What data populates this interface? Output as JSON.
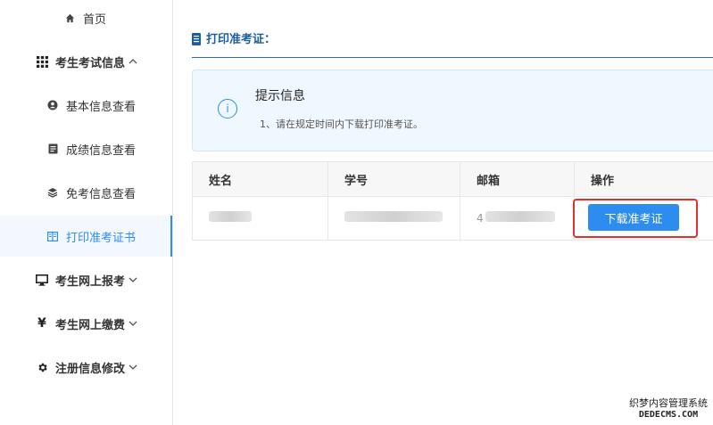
{
  "sidebar": {
    "items": [
      {
        "label": "首页",
        "icon": "home-icon",
        "top": 0
      },
      {
        "label": "考生考试信息",
        "icon": "grid-icon",
        "group": true,
        "expanded": true
      },
      {
        "label": "基本信息查看",
        "icon": "user-icon"
      },
      {
        "label": "成绩信息查看",
        "icon": "doc-icon"
      },
      {
        "label": "免考信息查看",
        "icon": "layers-icon"
      },
      {
        "label": "打印准考证书",
        "icon": "book-icon",
        "active": true
      },
      {
        "label": "考生网上报考",
        "icon": "monitor-icon",
        "group": true
      },
      {
        "label": "考生网上缴费",
        "icon": "yen-icon",
        "group": true
      },
      {
        "label": "注册信息修改",
        "icon": "gear-icon",
        "group": true
      }
    ]
  },
  "page": {
    "title": "打印准考证：",
    "title_icon": "book-icon"
  },
  "notice": {
    "title": "提示信息",
    "text": "1、请在规定时间内下载打印准考证。",
    "icon": "info-icon"
  },
  "table": {
    "headers": [
      "姓名",
      "学号",
      "邮箱",
      "操作"
    ],
    "row": {
      "email_prefix": "4"
    }
  },
  "actions": {
    "download_label": "下载准考证"
  },
  "watermark": {
    "line1": "织梦内容管理系统",
    "line2": "DEDECMS.COM"
  },
  "colors": {
    "accent": "#2d8cf0",
    "highlight": "#e5302f",
    "title": "#1b5ea8"
  }
}
